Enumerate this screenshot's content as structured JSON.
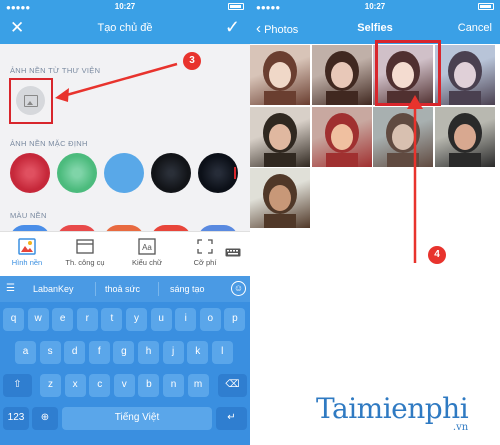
{
  "left": {
    "status": {
      "time": "10:27"
    },
    "nav": {
      "title": "Tạo chủ đề",
      "close_icon": "close-icon",
      "confirm_icon": "check-icon"
    },
    "sections": {
      "library": "ẢNH NỀN TỪ THƯ VIỆN",
      "default": "ẢNH NỀN MẶC ĐỊNH",
      "color": "MÀU NỀN"
    },
    "step_badge": "3",
    "toolbar": [
      {
        "label": "Hình nền",
        "icon": "wallpaper-icon",
        "active": true
      },
      {
        "label": "Th. công cụ",
        "icon": "toolbar-icon",
        "active": false
      },
      {
        "label": "Kiểu chữ",
        "icon": "font-icon",
        "active": false
      },
      {
        "label": "Cỡ phí",
        "icon": "resize-icon",
        "active": false
      }
    ],
    "keyboard": {
      "suggestions": [
        "LabanKey",
        "thoả sức",
        "sáng tạo"
      ],
      "row1": [
        "q",
        "w",
        "e",
        "r",
        "t",
        "y",
        "u",
        "i",
        "o",
        "p"
      ],
      "row2": [
        "a",
        "s",
        "d",
        "f",
        "g",
        "h",
        "j",
        "k",
        "l"
      ],
      "row3": [
        "z",
        "x",
        "c",
        "v",
        "b",
        "n",
        "m"
      ],
      "num_key": "123",
      "space": "Tiếng Việt",
      "accent": "#3a8fe0"
    }
  },
  "right": {
    "status": {
      "time": "10:27"
    },
    "nav": {
      "back": "Photos",
      "title": "Selfies",
      "cancel": "Cancel"
    },
    "step_badge": "4"
  },
  "watermark": {
    "brand": "Taimienphi",
    "domain": ".vn"
  }
}
